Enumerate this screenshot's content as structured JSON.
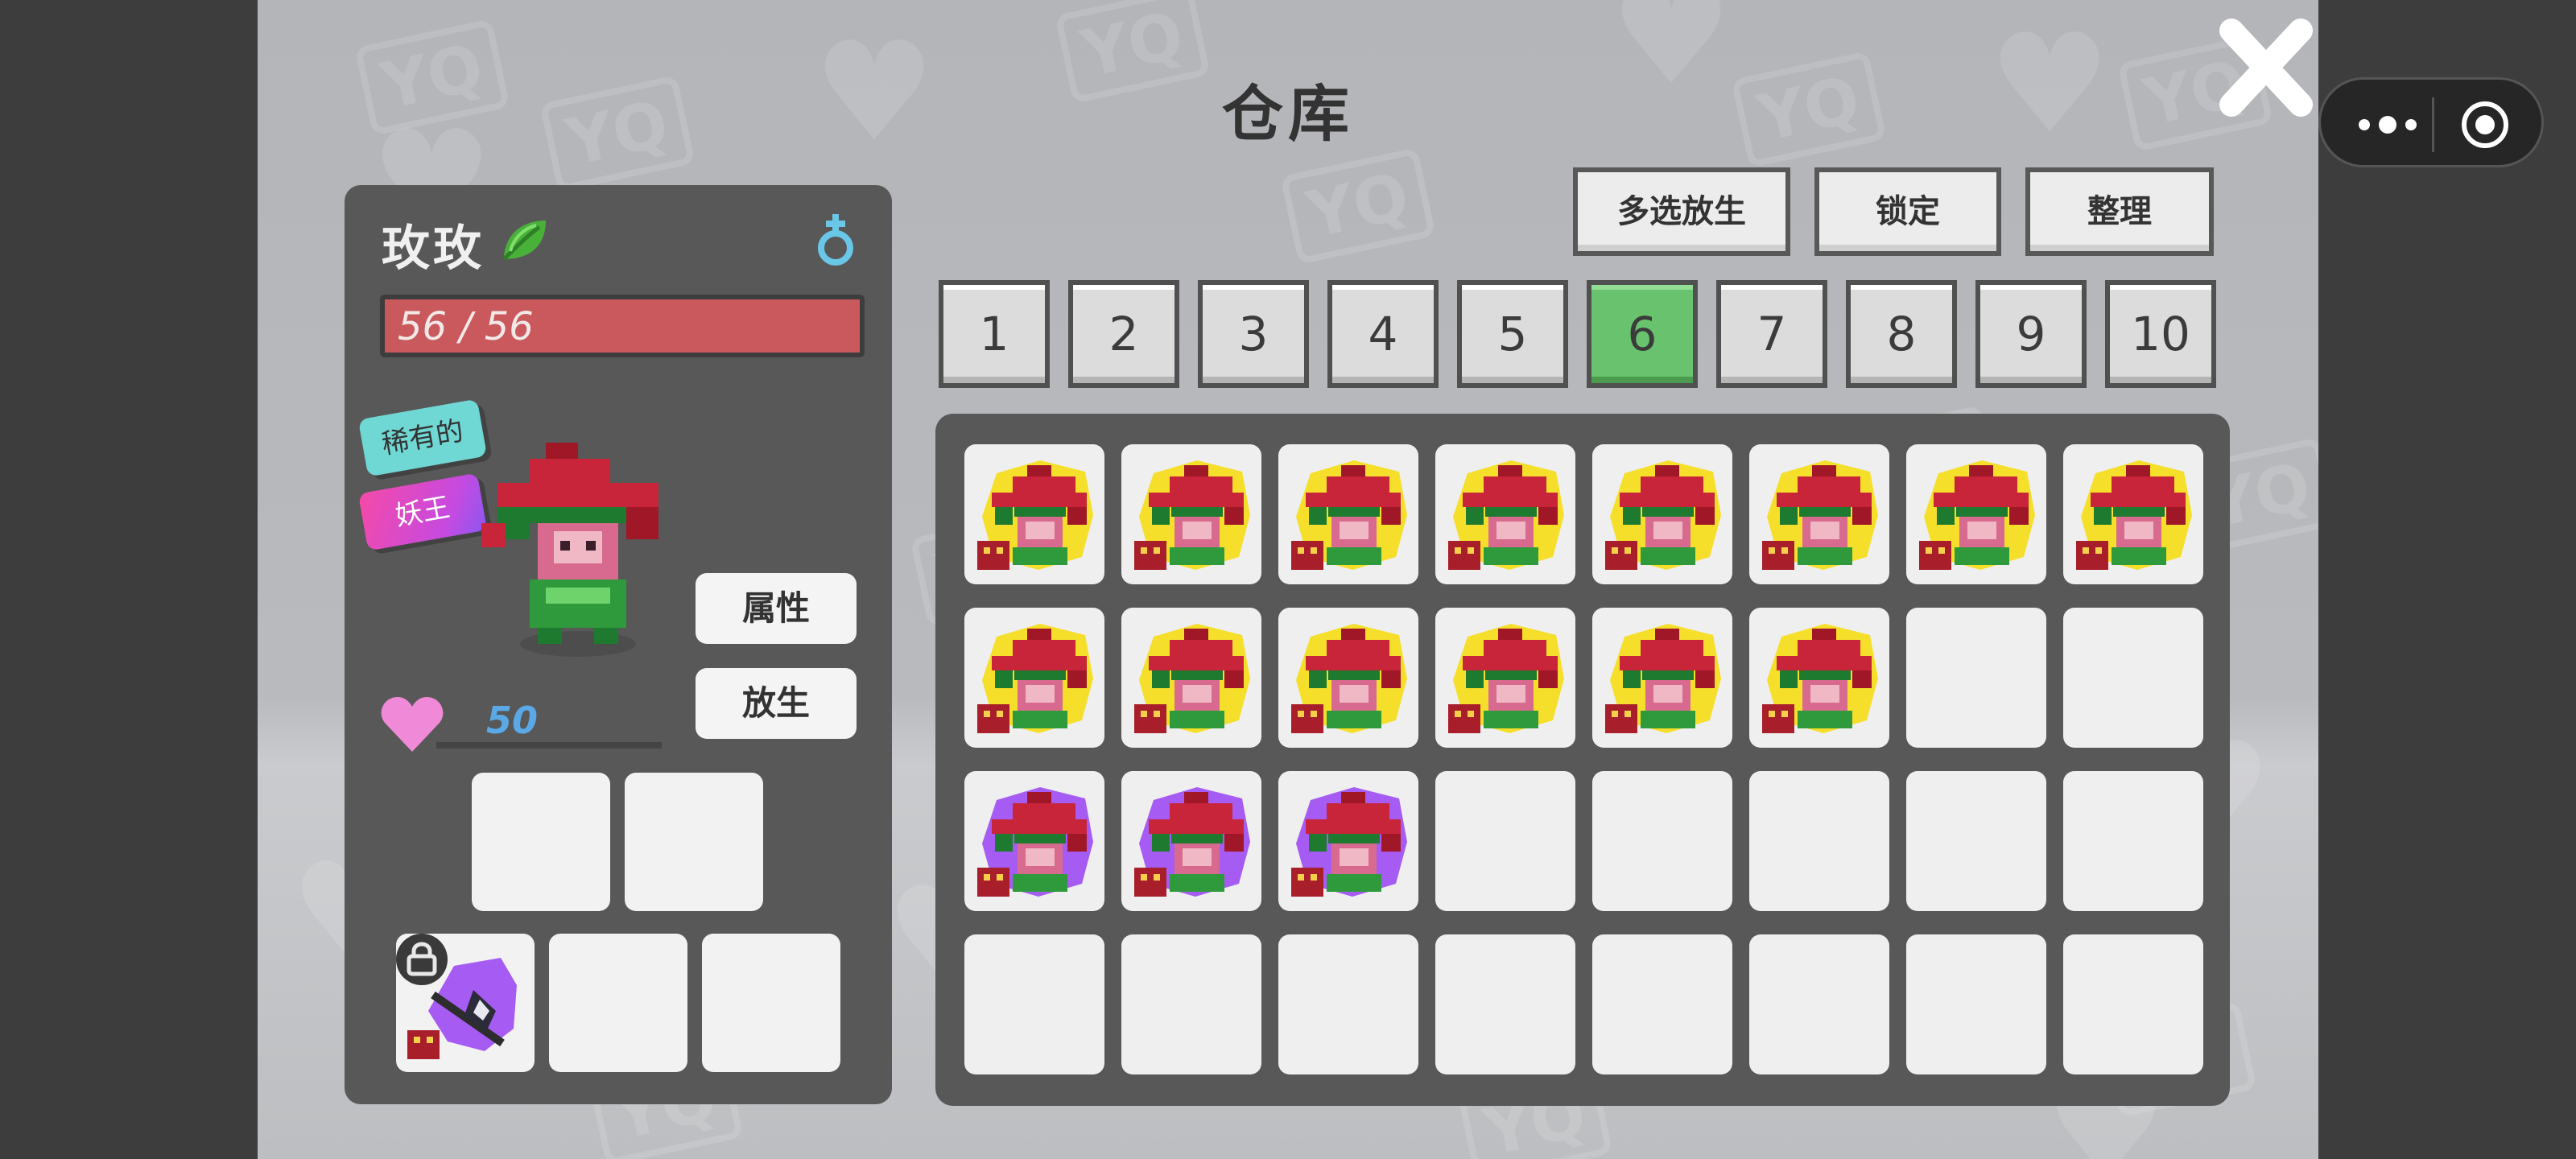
{
  "window": {
    "title": "仓库"
  },
  "actions": {
    "multi_release": "多选放生",
    "lock": "锁定",
    "sort": "整理"
  },
  "pages": [
    "1",
    "2",
    "3",
    "4",
    "5",
    "6",
    "7",
    "8",
    "9",
    "10"
  ],
  "active_page": "6",
  "pet": {
    "name": "玫玫",
    "hp": "56 / 56",
    "tags": [
      "稀有的",
      "妖王"
    ],
    "attributes_button": "属性",
    "release_button": "放生",
    "affection": "50"
  },
  "equipment_slots": {
    "row1": [
      "empty",
      "empty"
    ],
    "row2": [
      "locked-weapon",
      "empty",
      "empty"
    ]
  },
  "inventory": {
    "rows": [
      [
        "gold",
        "gold",
        "gold",
        "gold",
        "gold",
        "gold",
        "gold",
        "gold"
      ],
      [
        "gold",
        "gold",
        "gold",
        "gold",
        "gold",
        "gold",
        "empty",
        "empty"
      ],
      [
        "purple",
        "purple",
        "purple",
        "empty",
        "empty",
        "empty",
        "empty",
        "empty"
      ],
      [
        "empty",
        "empty",
        "empty",
        "empty",
        "empty",
        "empty",
        "empty",
        "empty"
      ]
    ]
  },
  "icons": {
    "close": "close-icon",
    "leaf": "leaf-icon",
    "gender": "female-symbol-icon",
    "heart": "heart-icon",
    "lock": "lock-icon",
    "more": "more-dots-icon",
    "target": "record-circle-icon"
  },
  "colors": {
    "active_tab": "#69c26d",
    "hp_bar": "#c9595c",
    "rarity_gold": "#f5df2a",
    "rarity_purple": "#a65cf2"
  }
}
